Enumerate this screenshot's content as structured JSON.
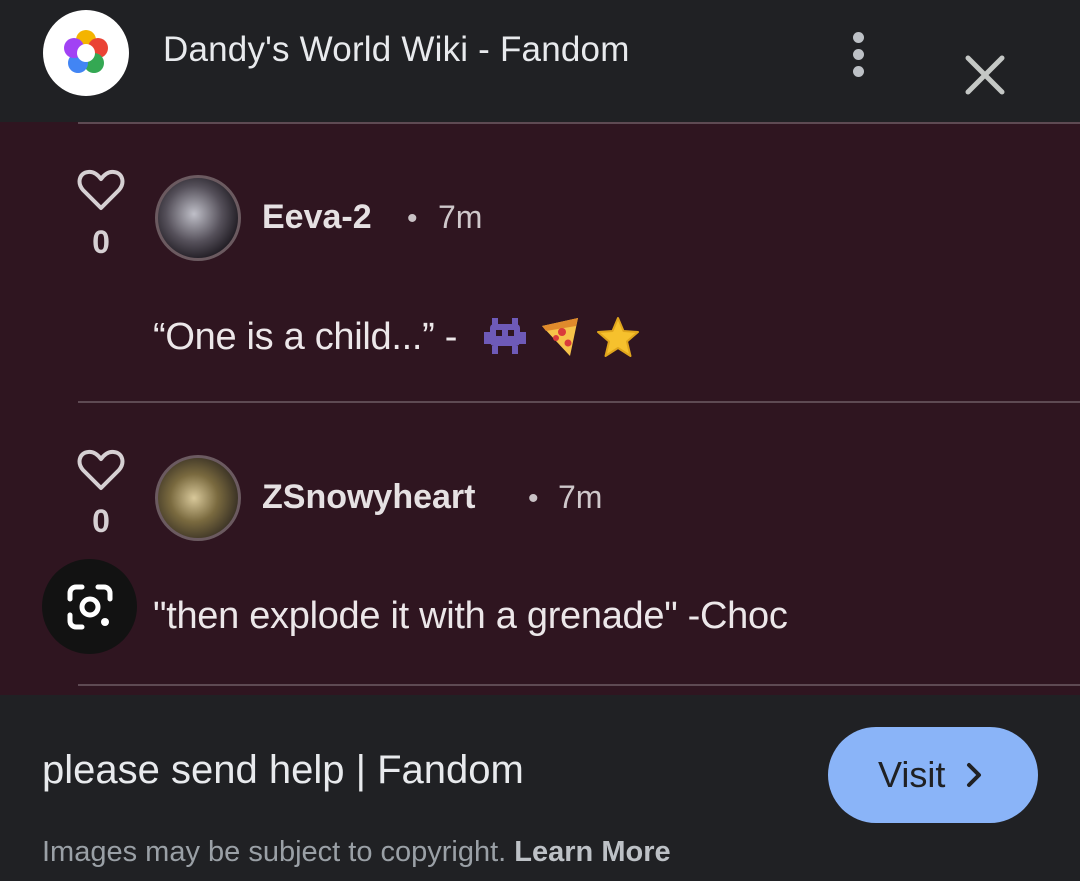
{
  "header": {
    "site_title": "Dandy's World Wiki - Fandom",
    "logo_icon": "fandom-flower-logo-icon",
    "more_icon": "more-vert-icon",
    "close_icon": "close-icon"
  },
  "comments": [
    {
      "likes": "0",
      "username": "Eeva-2",
      "separator": "•",
      "time": "7m",
      "text": "“One is a child...” -",
      "emojis": [
        "alien-monster-emoji",
        "pizza-emoji",
        "star-emoji"
      ]
    },
    {
      "likes": "0",
      "username": "ZSnowyheart",
      "separator": "•",
      "time": "7m",
      "text": "\"then explode it with a grenade\" -Choc"
    }
  ],
  "lens_icon": "google-lens-icon",
  "footer": {
    "page_title": "please send help | Fandom",
    "visit_label": "Visit",
    "copyright_text": "Images may be subject to copyright.",
    "learn_more": "Learn More"
  },
  "colors": {
    "background": "#202124",
    "image_background": "#2f1520",
    "visit_button": "#8ab4f8"
  }
}
